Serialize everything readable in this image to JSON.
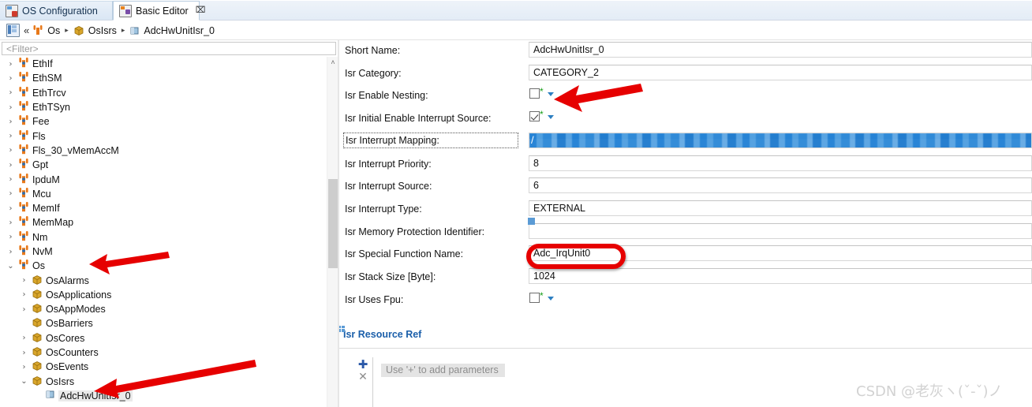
{
  "tabs": [
    {
      "label": "OS Configuration",
      "icon": "os-configuration-icon",
      "active": false,
      "closable": false
    },
    {
      "label": "Basic Editor",
      "icon": "basic-editor-icon",
      "active": true,
      "closable": true,
      "close_glyph": "⌧"
    }
  ],
  "breadcrumb": {
    "home_icon": "home-icon",
    "collapse_glyph": "«",
    "separator": "▸",
    "items": [
      {
        "label": "Os",
        "icon": "module-icon"
      },
      {
        "label": "OsIsrs",
        "icon": "container-icon"
      },
      {
        "label": "AdcHwUnitIsr_0",
        "icon": "element-icon"
      }
    ]
  },
  "tree_panel": {
    "filter_placeholder": "<Filter>",
    "scroll_up_glyph": "˄",
    "items": [
      {
        "label": "EthIf",
        "indent": 0,
        "twisty": "›",
        "icon": "module-icon"
      },
      {
        "label": "EthSM",
        "indent": 0,
        "twisty": "›",
        "icon": "module-icon"
      },
      {
        "label": "EthTrcv",
        "indent": 0,
        "twisty": "›",
        "icon": "module-icon"
      },
      {
        "label": "EthTSyn",
        "indent": 0,
        "twisty": "›",
        "icon": "module-icon"
      },
      {
        "label": "Fee",
        "indent": 0,
        "twisty": "›",
        "icon": "module-icon"
      },
      {
        "label": "Fls",
        "indent": 0,
        "twisty": "›",
        "icon": "module-icon"
      },
      {
        "label": "Fls_30_vMemAccM",
        "indent": 0,
        "twisty": "›",
        "icon": "module-icon"
      },
      {
        "label": "Gpt",
        "indent": 0,
        "twisty": "›",
        "icon": "module-icon"
      },
      {
        "label": "IpduM",
        "indent": 0,
        "twisty": "›",
        "icon": "module-icon"
      },
      {
        "label": "Mcu",
        "indent": 0,
        "twisty": "›",
        "icon": "module-icon"
      },
      {
        "label": "MemIf",
        "indent": 0,
        "twisty": "›",
        "icon": "module-icon"
      },
      {
        "label": "MemMap",
        "indent": 0,
        "twisty": "›",
        "icon": "module-icon"
      },
      {
        "label": "Nm",
        "indent": 0,
        "twisty": "›",
        "icon": "module-icon"
      },
      {
        "label": "NvM",
        "indent": 0,
        "twisty": "›",
        "icon": "module-icon"
      },
      {
        "label": "Os",
        "indent": 0,
        "twisty": "⌄",
        "icon": "module-icon"
      },
      {
        "label": "OsAlarms",
        "indent": 1,
        "twisty": "›",
        "icon": "container-icon"
      },
      {
        "label": "OsApplications",
        "indent": 1,
        "twisty": "›",
        "icon": "container-icon"
      },
      {
        "label": "OsAppModes",
        "indent": 1,
        "twisty": "›",
        "icon": "container-icon"
      },
      {
        "label": "OsBarriers",
        "indent": 1,
        "twisty": "",
        "icon": "container-icon"
      },
      {
        "label": "OsCores",
        "indent": 1,
        "twisty": "›",
        "icon": "container-icon"
      },
      {
        "label": "OsCounters",
        "indent": 1,
        "twisty": "›",
        "icon": "container-icon"
      },
      {
        "label": "OsEvents",
        "indent": 1,
        "twisty": "›",
        "icon": "container-icon"
      },
      {
        "label": "OsIsrs",
        "indent": 1,
        "twisty": "⌄",
        "icon": "container-icon"
      },
      {
        "label": "AdcHwUnitIsr_0",
        "indent": 2,
        "twisty": "",
        "icon": "element-icon",
        "selected": true
      }
    ]
  },
  "form": {
    "rows": [
      {
        "label": "Short Name:",
        "type": "text",
        "value": "AdcHwUnitIsr_0"
      },
      {
        "label": "Isr Category:",
        "type": "text",
        "value": "CATEGORY_2"
      },
      {
        "label": "Isr Enable Nesting:",
        "type": "checkbox",
        "checked": false,
        "required_marker": "*"
      },
      {
        "label": "Isr Initial Enable Interrupt Source:",
        "type": "checkbox",
        "checked": true,
        "required_marker": "*"
      },
      {
        "label": "Isr Interrupt Mapping:",
        "type": "redacted",
        "value": "/",
        "label_focused": true
      },
      {
        "label": "Isr Interrupt Priority:",
        "type": "text",
        "value": "8"
      },
      {
        "label": "Isr Interrupt Source:",
        "type": "text",
        "value": "6"
      },
      {
        "label": "Isr Interrupt Type:",
        "type": "text",
        "value": "EXTERNAL"
      },
      {
        "label": "Isr Memory Protection Identifier:",
        "type": "text",
        "value": "",
        "marker": true
      },
      {
        "label": "Isr Special Function Name:",
        "type": "text",
        "value": "Adc_IrqUnit0",
        "highlighted": true
      },
      {
        "label": "Isr Stack Size [Byte]:",
        "type": "text",
        "value": "1024"
      },
      {
        "label": "Isr Uses Fpu:",
        "type": "checkbox",
        "checked": false,
        "required_marker": "*"
      }
    ],
    "section": {
      "title": "Isr Resource Ref",
      "add_glyph": "✚",
      "delete_glyph": "✕",
      "placeholder": "Use '+' to add parameters"
    }
  },
  "annotations": {
    "arrow_color": "#e60000",
    "highlight_color": "#e60000",
    "watermark": "CSDN @老灰ヽ(ˇ-ˇ)ノ"
  }
}
